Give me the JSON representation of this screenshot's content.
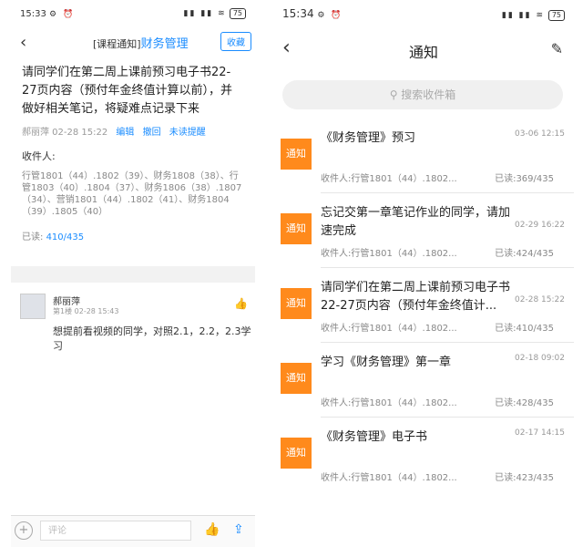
{
  "left": {
    "status": {
      "time": "15:33",
      "icons": "⚙ ⏰",
      "signal": "▮▮ ▮▮ ≋",
      "battery": "75"
    },
    "nav": {
      "back": "‹",
      "prefix": "[课程通知]",
      "title": "财务管理",
      "collect": "收藏"
    },
    "message": "请同学们在第二周上课前预习电子书22-27页内容（预付年金终值计算以前），并做好相关笔记，将疑难点记录下来",
    "meta": {
      "author_time": "郝丽萍  02-28 15:22",
      "edit": "编辑",
      "recall": "撤回",
      "remind": "未读提醒"
    },
    "recipients_label": "收件人:",
    "recipients": "行管1801（44）.1802（39）、财务1808（38）、行管1803（40）.1804（37）、财务1806（38）.1807（34）、营销1801（44）.1802（41）、财务1804（39）.1805（40）",
    "read_label": "已读:",
    "read_value": "410/435",
    "comment": {
      "name": "郝丽萍",
      "floor": "第1楼",
      "time": "02-28 15:43",
      "text": "想提前看视频的同学，对照2.1，2.2，2.3学习"
    },
    "footer": {
      "placeholder": "评论"
    }
  },
  "right": {
    "status": {
      "time": "15:34",
      "icons": "⚙ ⏰",
      "signal": "▮▮ ▮▮ ≋",
      "battery": "75"
    },
    "nav": {
      "back": "‹",
      "title": "通知",
      "edit": "✎"
    },
    "search_placeholder": "搜索收件箱",
    "items": [
      {
        "tag": "通知",
        "title": "《财务管理》预习",
        "time": "03-06 12:15",
        "recipients": "收件人:行管1801（44）.1802...",
        "read": "已读:369/435"
      },
      {
        "tag": "通知",
        "title": "忘记交第一章笔记作业的同学，请加速完成",
        "time": "02-29 16:22",
        "recipients": "收件人:行管1801（44）.1802...",
        "read": "已读:424/435"
      },
      {
        "tag": "通知",
        "title": "请同学们在第二周上课前预习电子书22-27页内容（预付年金终值计...",
        "time": "02-28 15:22",
        "recipients": "收件人:行管1801（44）.1802...",
        "read": "已读:410/435"
      },
      {
        "tag": "通知",
        "title": "学习《财务管理》第一章",
        "time": "02-18 09:02",
        "recipients": "收件人:行管1801（44）.1802...",
        "read": "已读:428/435"
      },
      {
        "tag": "通知",
        "title": "《财务管理》电子书",
        "time": "02-17 14:15",
        "recipients": "收件人:行管1801（44）.1802...",
        "read": "已读:423/435"
      }
    ]
  }
}
